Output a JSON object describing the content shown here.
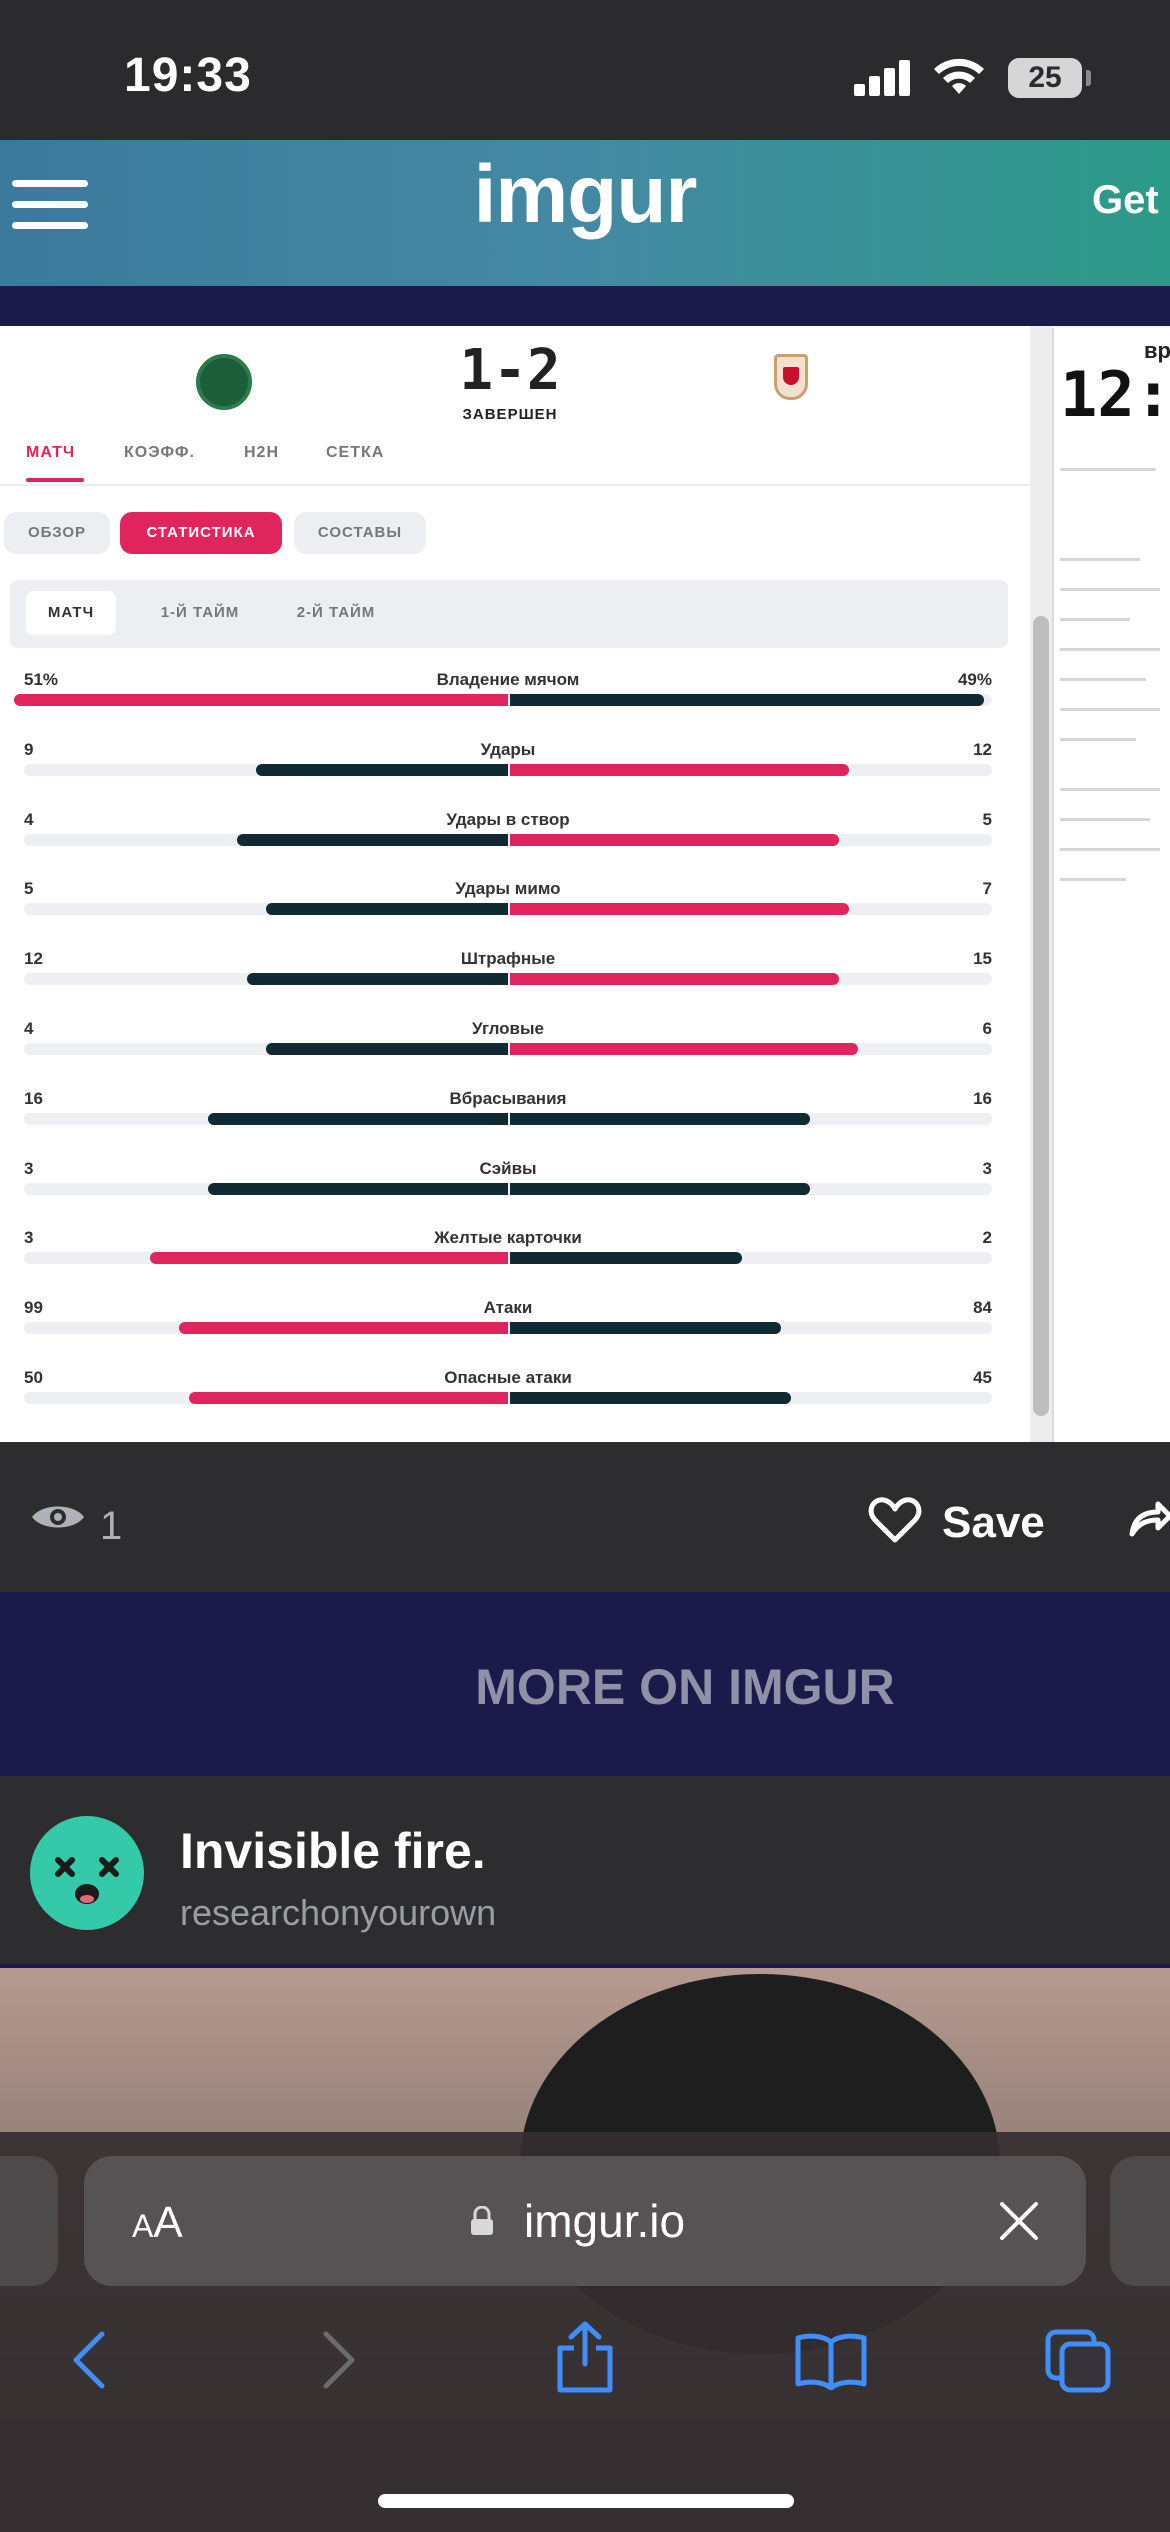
{
  "status_bar": {
    "time": "19:33",
    "battery": "25"
  },
  "header": {
    "logo": "imgur",
    "get_label": "Get"
  },
  "post_image": {
    "score": "1-2",
    "match_status": "ЗАВЕРШЕН",
    "tabs": [
      "МАТЧ",
      "КОЭФФ.",
      "H2H",
      "СЕТКА"
    ],
    "active_tab": "МАТЧ",
    "sub_tabs": [
      "ОБЗОР",
      "СТАТИСТИКА",
      "СОСТАВЫ"
    ],
    "active_sub_tab": "СТАТИСТИКА",
    "periods": [
      "МАТЧ",
      "1-Й ТАЙМ",
      "2-Й ТАЙМ"
    ],
    "active_period": "МАТЧ",
    "colors": {
      "accent": "#e0245e",
      "dark": "#0f2a33",
      "track": "#eeeff2"
    },
    "stats": [
      {
        "label": "Владение мячом",
        "home": "51%",
        "away": "49%",
        "home_fill": 0.51,
        "away_fill": 0.49,
        "home_color": "#e0245e",
        "away_color": "#0f2a33"
      },
      {
        "label": "Удары",
        "home": "9",
        "away": "12",
        "home_fill": 0.26,
        "away_fill": 0.35,
        "home_color": "#0f2a33",
        "away_color": "#e0245e"
      },
      {
        "label": "Удары в створ",
        "home": "4",
        "away": "5",
        "home_fill": 0.28,
        "away_fill": 0.34,
        "home_color": "#0f2a33",
        "away_color": "#e0245e"
      },
      {
        "label": "Удары мимо",
        "home": "5",
        "away": "7",
        "home_fill": 0.25,
        "away_fill": 0.35,
        "home_color": "#0f2a33",
        "away_color": "#e0245e"
      },
      {
        "label": "Штрафные",
        "home": "12",
        "away": "15",
        "home_fill": 0.27,
        "away_fill": 0.34,
        "home_color": "#0f2a33",
        "away_color": "#e0245e"
      },
      {
        "label": "Угловые",
        "home": "4",
        "away": "6",
        "home_fill": 0.25,
        "away_fill": 0.36,
        "home_color": "#0f2a33",
        "away_color": "#e0245e"
      },
      {
        "label": "Вбрасывания",
        "home": "16",
        "away": "16",
        "home_fill": 0.31,
        "away_fill": 0.31,
        "home_color": "#0f2a33",
        "away_color": "#0f2a33"
      },
      {
        "label": "Сэйвы",
        "home": "3",
        "away": "3",
        "home_fill": 0.31,
        "away_fill": 0.31,
        "home_color": "#0f2a33",
        "away_color": "#0f2a33"
      },
      {
        "label": "Желтые карточки",
        "home": "3",
        "away": "2",
        "home_fill": 0.37,
        "away_fill": 0.24,
        "home_color": "#e0245e",
        "away_color": "#0f2a33"
      },
      {
        "label": "Атаки",
        "home": "99",
        "away": "84",
        "home_fill": 0.34,
        "away_fill": 0.28,
        "home_color": "#e0245e",
        "away_color": "#0f2a33"
      },
      {
        "label": "Опасные атаки",
        "home": "50",
        "away": "45",
        "home_fill": 0.33,
        "away_fill": 0.29,
        "home_color": "#e0245e",
        "away_color": "#0f2a33"
      }
    ],
    "side_panel": {
      "big_text": "12:",
      "small_text": "вр"
    }
  },
  "actions": {
    "views": "1",
    "save_label": "Save"
  },
  "more_section": {
    "title": "MORE ON IMGUR"
  },
  "related_post": {
    "title": "Invisible fire.",
    "author": "researchonyourown"
  },
  "browser": {
    "aa_small": "A",
    "aa_large": "A",
    "url": "imgur.io"
  },
  "icons": {
    "menu": "hamburger-menu-icon",
    "views": "eye-icon",
    "save": "heart-icon",
    "share": "share-icon",
    "url_lock": "lock-icon",
    "url_clear": "close-icon",
    "back": "chevron-left-icon",
    "forward": "chevron-right-icon",
    "browser_share": "share-box-icon",
    "bookmarks": "book-icon",
    "tabs": "tabs-icon"
  }
}
